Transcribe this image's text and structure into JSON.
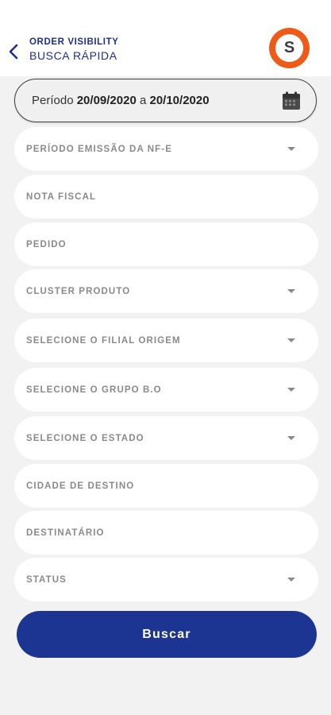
{
  "header": {
    "app_name": "ORDER VISIBILITY",
    "screen_title": "BUSCA RÁPIDA",
    "back_icon": "chevron-left-icon",
    "logo_letter": "S"
  },
  "period": {
    "label": "Período",
    "start": "20/09/2020",
    "connector": "a",
    "end": "20/10/2020",
    "icon": "calendar-icon"
  },
  "filters": [
    {
      "label": "PERÍODO EMISSÃO DA NF-E",
      "dropdown": true
    },
    {
      "label": "NOTA FISCAL",
      "dropdown": false
    },
    {
      "label": "PEDIDO",
      "dropdown": false
    },
    {
      "label": "CLUSTER PRODUTO",
      "dropdown": true
    },
    {
      "label": "SELECIONE O FILIAL ORIGEM",
      "dropdown": true
    },
    {
      "label": "SELECIONE O GRUPO B.O",
      "dropdown": true
    },
    {
      "label": "SELECIONE O ESTADO",
      "dropdown": true
    },
    {
      "label": "CIDADE DE DESTINO",
      "dropdown": false
    },
    {
      "label": "DESTINATÁRIO",
      "dropdown": false
    },
    {
      "label": "STATUS",
      "dropdown": true
    }
  ],
  "search_button": {
    "label": "Buscar"
  },
  "colors": {
    "brand_blue": "#1c3593",
    "logo_orange": "#ee5a17",
    "background": "#f2f2f2"
  }
}
